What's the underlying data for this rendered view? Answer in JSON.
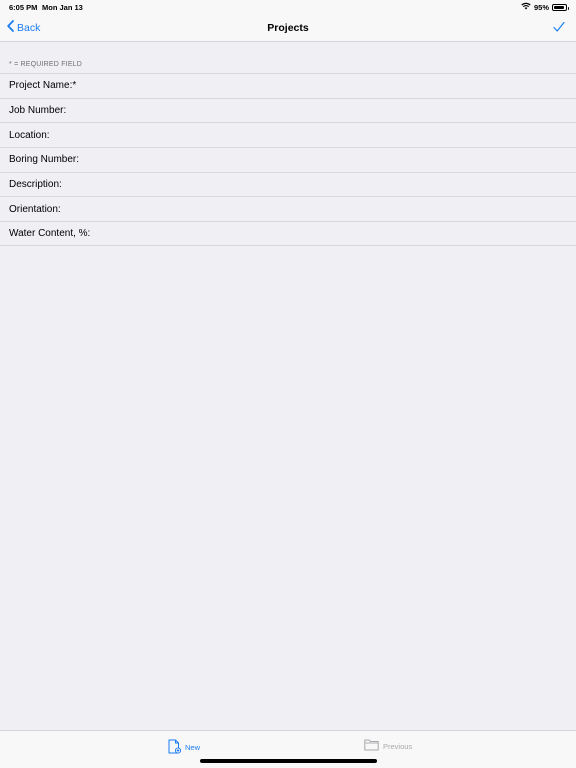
{
  "status_bar": {
    "time": "6:05 PM",
    "date": "Mon Jan 13",
    "battery_percent": "95%",
    "battery_level": 0.95
  },
  "nav": {
    "back_label": "Back",
    "title": "Projects",
    "accent_color": "#1a7cf2"
  },
  "form": {
    "section_header": "* = REQUIRED FIELD",
    "fields": [
      {
        "label": "Project Name:*",
        "value": ""
      },
      {
        "label": "Job Number:",
        "value": ""
      },
      {
        "label": "Location:",
        "value": ""
      },
      {
        "label": "Boring Number:",
        "value": ""
      },
      {
        "label": "Description:",
        "value": ""
      },
      {
        "label": "Orientation:",
        "value": ""
      },
      {
        "label": "Water Content, %:",
        "value": ""
      }
    ]
  },
  "tab_bar": {
    "new_label": "New",
    "previous_label": "Previous",
    "new_icon": "new-document-icon",
    "previous_icon": "folder-icon"
  }
}
